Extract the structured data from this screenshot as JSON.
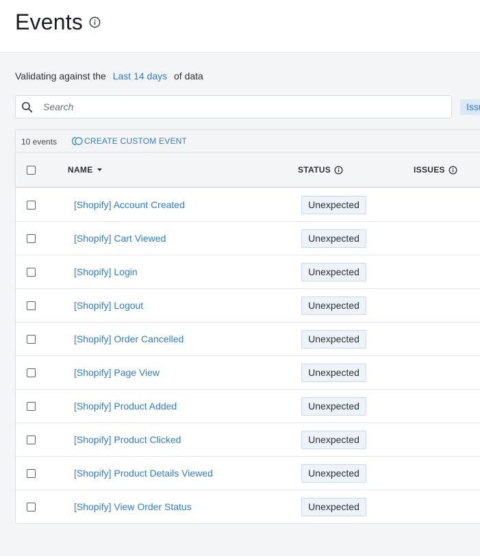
{
  "header": {
    "title": "Events"
  },
  "validation": {
    "prefix": "Validating against the",
    "range": "Last 14 days",
    "suffix": "of data"
  },
  "search": {
    "placeholder": "Search",
    "value": ""
  },
  "issues_chip": "Issu",
  "toolbar": {
    "event_count": "10 events",
    "create_label": "CREATE CUSTOM EVENT"
  },
  "columns": {
    "name": "NAME",
    "status": "STATUS",
    "issues": "ISSUES"
  },
  "rows": [
    {
      "name": "[Shopify] Account Created",
      "status": "Unexpected"
    },
    {
      "name": "[Shopify] Cart Viewed",
      "status": "Unexpected"
    },
    {
      "name": "[Shopify] Login",
      "status": "Unexpected"
    },
    {
      "name": "[Shopify] Logout",
      "status": "Unexpected"
    },
    {
      "name": "[Shopify] Order Cancelled",
      "status": "Unexpected"
    },
    {
      "name": "[Shopify] Page View",
      "status": "Unexpected"
    },
    {
      "name": "[Shopify] Product Added",
      "status": "Unexpected"
    },
    {
      "name": "[Shopify] Product Clicked",
      "status": "Unexpected"
    },
    {
      "name": "[Shopify] Product Details Viewed",
      "status": "Unexpected"
    },
    {
      "name": "[Shopify] View Order Status",
      "status": "Unexpected"
    }
  ],
  "colors": {
    "accent": "#2f7dd1",
    "status_bg": "#eef3f9",
    "status_border": "#c9d9ee"
  },
  "icons": {
    "title_info": "info-icon",
    "search": "search-icon",
    "create": "circle-plus-icon",
    "sort": "sort-down-icon"
  }
}
